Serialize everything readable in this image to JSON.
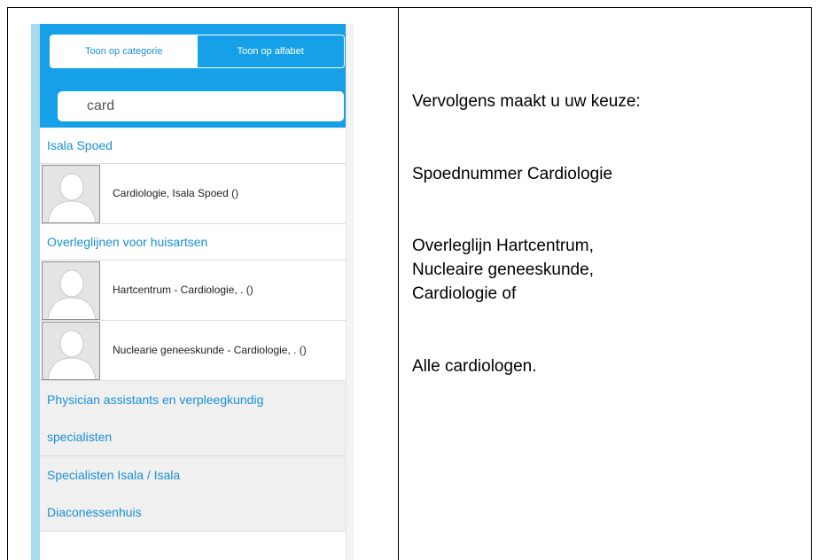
{
  "app": {
    "toggle": {
      "by_category": "Toon op categorie",
      "by_alphabet": "Toon op alfabet"
    },
    "search": {
      "value": "card"
    },
    "groups": [
      {
        "title": "Isala Spoed",
        "contacts": [
          {
            "name": "Cardiologie, Isala Spoed ()"
          }
        ]
      },
      {
        "title": "Overleglijnen voor huisartsen",
        "contacts": [
          {
            "name": "Hartcentrum - Cardiologie, . ()"
          },
          {
            "name": "Nuclearie geneeskunde - Cardiologie, . ()"
          }
        ]
      },
      {
        "title_line1": "Physician assistants en verpleegkundig",
        "title_line2": "specialisten"
      },
      {
        "title_line1": "Specialisten Isala / Isala",
        "title_line2": "Diaconessenhuis"
      }
    ]
  },
  "instructions": {
    "intro": "Vervolgens maakt u uw keuze:",
    "option1": "Spoednummer Cardiologie",
    "option2_line1": "Overleglijn Hartcentrum,",
    "option2_line2": "Nucleaire geneeskunde,",
    "option2_line3": "Cardiologie of",
    "option3": "Alle cardiologen."
  },
  "colors": {
    "accent": "#15a0e8",
    "link": "#1a8fd6",
    "stripe": "#a9dbef"
  },
  "icons": {
    "avatar": "user-placeholder-icon",
    "scroll": "chevron-up-icon"
  }
}
